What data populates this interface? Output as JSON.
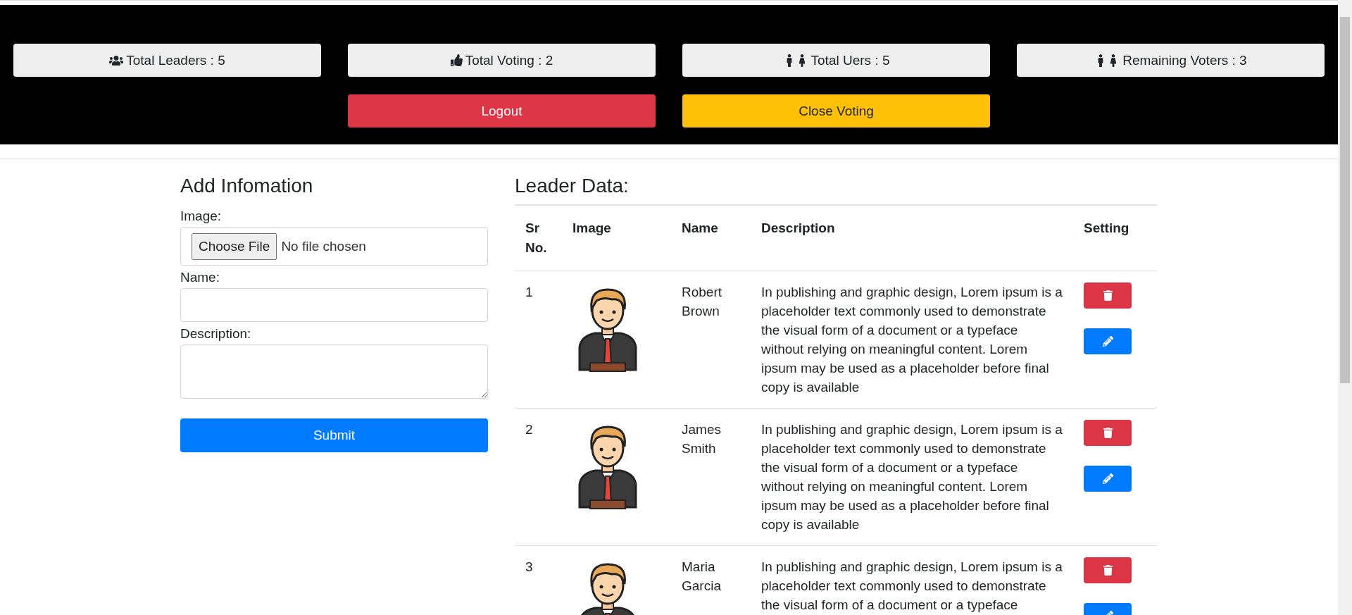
{
  "stats": [
    {
      "kind": "group",
      "label": "Total Leaders : 5"
    },
    {
      "kind": "vote",
      "label": "Total Voting : 2"
    },
    {
      "kind": "person",
      "label": "Total Uers : 5"
    },
    {
      "kind": "person",
      "label": "Remaining Voters : 3"
    }
  ],
  "actions": [
    {
      "kind": "danger",
      "label": "Logout"
    },
    {
      "kind": "warning",
      "label": "Close Voting"
    }
  ],
  "form": {
    "title": "Add Infomation",
    "image_label": "Image:",
    "file_button": "Choose File",
    "file_status": "No file chosen",
    "name_label": "Name:",
    "description_label": "Description:",
    "submit": "Submit"
  },
  "table": {
    "title": "Leader Data:",
    "columns": [
      "Sr No.",
      "Image",
      "Name",
      "Description",
      "Setting"
    ],
    "rows": [
      {
        "sr": "1",
        "name": "Robert Brown",
        "description": "In publishing and graphic design, Lorem ipsum is a placeholder text commonly used to demonstrate the visual form of a document or a typeface without relying on meaningful content. Lorem ipsum may be used as a placeholder before final copy is available"
      },
      {
        "sr": "2",
        "name": "James Smith",
        "description": "In publishing and graphic design, Lorem ipsum is a placeholder text commonly used to demonstrate the visual form of a document or a typeface without relying on meaningful content. Lorem ipsum may be used as a placeholder before final copy is available"
      },
      {
        "sr": "3",
        "name": "Maria Garcia",
        "description": "In publishing and graphic design, Lorem ipsum is a placeholder text commonly used to demonstrate the visual form of a document or a typeface"
      }
    ]
  }
}
